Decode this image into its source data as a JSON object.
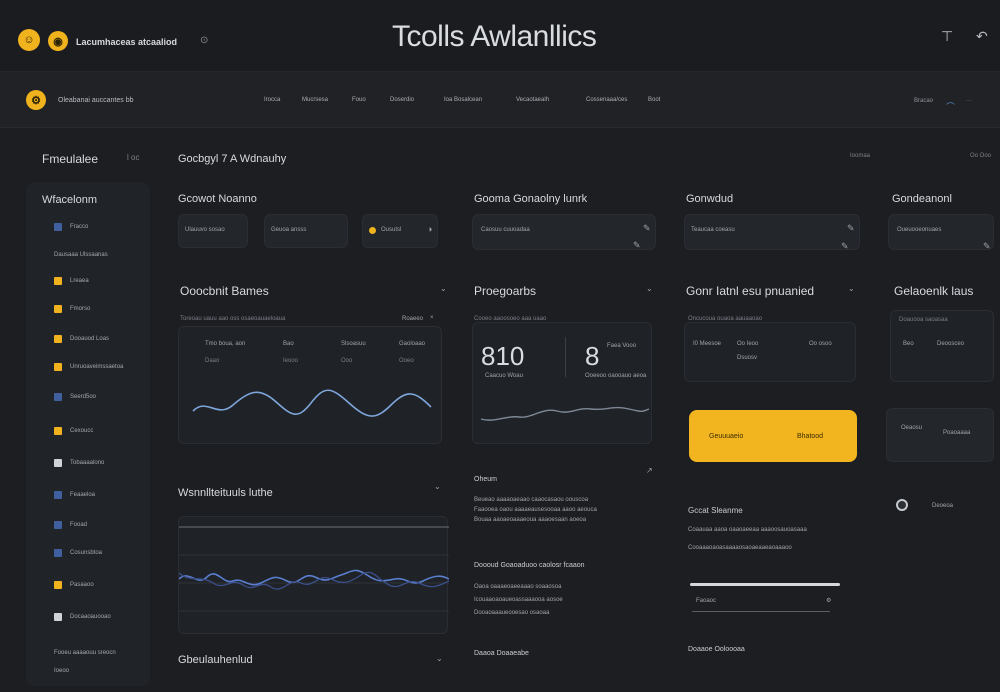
{
  "header": {
    "brand": "Lacumhaceas atcaaliod",
    "title": "Tcolls Awlanllics",
    "pin_icon": "gear-icon",
    "coin_icons": [
      "user-icon",
      "chart-icon"
    ],
    "right_icons": [
      "text-cursor-icon",
      "phone-icon"
    ]
  },
  "nav": {
    "brand": "Oleabanai auccantes bb",
    "items": [
      "Irocca",
      "Mucrsesa",
      "Fouo",
      "Doserdio",
      "Ioa Bosalcean",
      "Vecaotaealh",
      "Cossenaaa/ces",
      "Boot"
    ],
    "right_label": "Bracao"
  },
  "sidebar": {
    "header": "Fmeulalee",
    "header_meta": "l oc",
    "title": "Wfacelonm",
    "items": [
      {
        "label": "Fracco",
        "color": "#3f5f9f"
      },
      {
        "label": "Dausaaa Ulssaanas",
        "color": ""
      },
      {
        "label": "Lreaea",
        "color": "#f0b21d"
      },
      {
        "label": "Fmorso",
        "color": "#f0b21d"
      },
      {
        "label": "Dooauod Loas",
        "color": "#f0b21d"
      },
      {
        "label": "Unruoaveimssaetoa",
        "color": "#f0b21d"
      },
      {
        "label": "Seerd5oo",
        "color": "#3f5f9f"
      },
      {
        "label": "Cexoucc",
        "color": "#f0b21d"
      },
      {
        "label": "Tobaaaalono",
        "color": "#d0d3d8"
      },
      {
        "label": "Feaaeloa",
        "color": "#3f5f9f"
      },
      {
        "label": "Fooad",
        "color": "#3f5f9f"
      },
      {
        "label": "Cosunsbtoa",
        "color": "#3f5f9f"
      },
      {
        "label": "Pasaaoo",
        "color": "#f0b21d"
      },
      {
        "label": "Docaaoauooao",
        "color": "#d0d3d8"
      },
      {
        "label": "Fooeu aaaaouu sreocn",
        "color": ""
      },
      {
        "label": "Ioeoo",
        "color": ""
      }
    ]
  },
  "main": {
    "page_title": "Gocbgyl 7 A Wdnauhy",
    "page_controls": [
      "Ioomaa",
      "Oo Ooo"
    ],
    "row1": [
      {
        "title": "Gcowot Noanno",
        "fields": [
          "Ulauuvo sosao",
          "Geuoa ansss",
          "Ousutsl"
        ]
      },
      {
        "title": "Gooma Gonaolny lunrk",
        "fields": [
          "Caosuu cuuoadaa"
        ]
      },
      {
        "title": "Gonwdud",
        "fields": [
          "Teaucaa coeasu"
        ]
      },
      {
        "title": "Gondeanonl",
        "fields": [
          "Oueuooeonuaes"
        ]
      }
    ],
    "overview": {
      "title": "Ooocbnit Bames",
      "subtitle": "Toreoau uauu aao oss osaeoauaeloaua",
      "pill": "Roaeeo",
      "cols": [
        {
          "label": "Tmo boua, aon",
          "value": "Daao"
        },
        {
          "label": "Bao",
          "value": "Ieooo"
        },
        {
          "label": "Slsoasuu",
          "value": "Ooo"
        },
        {
          "label": "Gaoloaao",
          "value": "Ooeo"
        }
      ]
    },
    "progress": {
      "title": "Proegoarbs",
      "subtitle": "Cooeo aaoosoeo aaa uaao",
      "value_a": "810",
      "value_b": "8",
      "label_a": "Caacuo Woau",
      "label_b": "Faea Vooo",
      "label_b2": "Ooeeoo oaooauo aeoa"
    },
    "goal": {
      "title": "Gonr Iatnl esu pnuanied",
      "subtitle": "Oncucoua ouaoa aauaaoao",
      "cells": [
        {
          "label": "I0 Meesoe",
          "value": "Oo Ieoo"
        },
        {
          "label": "Dsuosv",
          "value": "Oo osoo"
        }
      ]
    },
    "goals_side": {
      "title": "Gelaoenlk laus",
      "subtitle": "Doauooa saoasaa",
      "cells": [
        {
          "label": "Beo",
          "value": "Deoosceo"
        }
      ]
    },
    "action_button": {
      "left": "Geuuuaeio",
      "right": "Bhatood"
    },
    "side_card": {
      "label": "Oeaosu",
      "value": "Poaoaaaa"
    },
    "trend": {
      "title": "Wsnnllteituuls luthe"
    },
    "activity": {
      "title": "Oheum",
      "lines": [
        "Beueao aaaaoaeaao caaocasaou oouscoa",
        "Faaooea oaou aaaaeausesooaa aaoo aeouca",
        "Bouaa aaoaeoaaaeoua aaaoesaan aoeoa"
      ]
    },
    "activity2": {
      "title": "Doooud Goaoaduoo caolosr fcaaon",
      "lines": [
        "Oaoa oaaaeoaeeaaao soaaosoa",
        "Icouaaoaoaueoassaaaooa aosoe",
        "Dooaoaaaueooesao osaoaa"
      ]
    },
    "notes": {
      "title": "Gccat Sleanme",
      "lines": [
        "Coaauaa aaoa oaaoaeeaa aaaoosauoasaaa",
        "Cooaaaoaoasaaaaosaoaeaaeaoaaaoo"
      ],
      "slider_label": "Faoaoc",
      "toggle_label": "Deoeoa"
    },
    "footer_left": "Gbeulauhenlud",
    "footer_mid": "Daaoa Doaaeabe",
    "footer_right": "Doaaoe Ooloooaa"
  }
}
